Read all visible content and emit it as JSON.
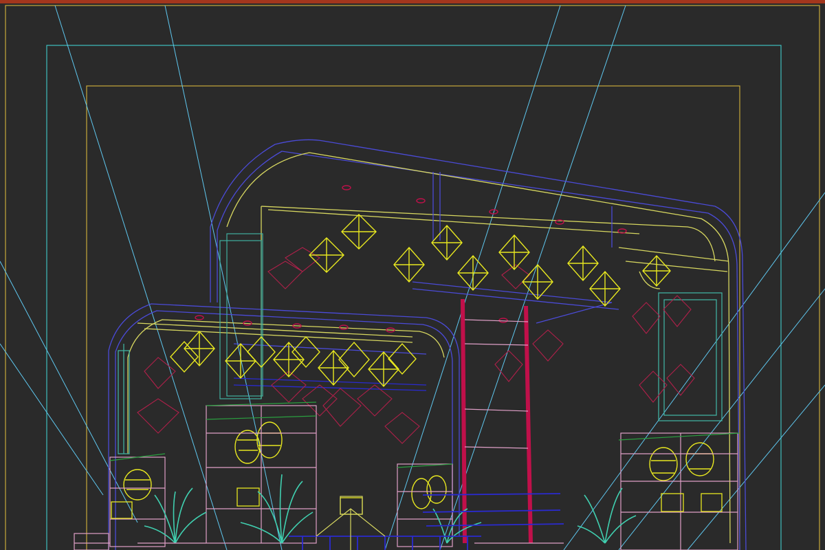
{
  "app": {
    "view": "perspective-viewport",
    "render_mode": "wireframe"
  },
  "colors": {
    "background": "#2a2a2a",
    "active_border": "#a3361d",
    "safe_frame_outer": "#3fbfbf",
    "safe_frame_inner": "#c8a83a",
    "camera_lines": "#5fc8f0",
    "booth_outline": "#4b4bd8",
    "booth_inner": "#d8d860",
    "pendant_lamps": "#e8e820",
    "wall_panels": "#b0204a",
    "columns": "#c0104a",
    "shelves": "#e0a0c8",
    "plants": "#40d0b0",
    "counter": "#2a2ad0",
    "window_frames": "#40b0a0"
  },
  "icons": [
    "camera-frustum-icon",
    "pendant-lamp-icon",
    "potted-plant-icon"
  ]
}
